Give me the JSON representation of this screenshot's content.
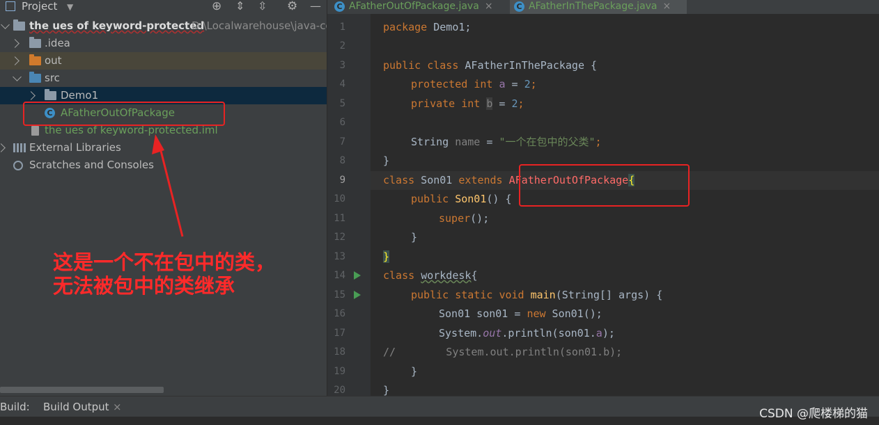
{
  "project_panel": {
    "title": "Project",
    "tree": [
      {
        "label": "the ues of keyword-protected",
        "path": "D:\\Localwarehouse\\java-co",
        "type": "project-root"
      },
      {
        "label": ".idea",
        "type": "folder"
      },
      {
        "label": "out",
        "type": "folder"
      },
      {
        "label": "src",
        "type": "folder"
      },
      {
        "label": "Demo1",
        "type": "package"
      },
      {
        "label": "AFatherOutOfPackage",
        "type": "class"
      },
      {
        "label": "the ues of keyword-protected.iml",
        "type": "file"
      },
      {
        "label": "External Libraries",
        "type": "library"
      },
      {
        "label": "Scratches and Consoles",
        "type": "scratches"
      }
    ]
  },
  "editor": {
    "tabs": [
      {
        "label": "AFatherOutOfPackage.java",
        "active": false
      },
      {
        "label": "AFatherInThePackage.java",
        "active": true
      }
    ],
    "line_numbers": [
      "1",
      "2",
      "3",
      "4",
      "5",
      "6",
      "7",
      "8",
      "9",
      "10",
      "11",
      "12",
      "13",
      "14",
      "15",
      "16",
      "17",
      "18",
      "19",
      "20"
    ],
    "tokens": {
      "package": "package",
      "demo1": " Demo1;",
      "public": "public",
      "class": "class",
      "cls_name": " AFatherInThePackage {",
      "protected": "protected",
      "int": "int",
      "var_a": "a",
      "eq2": " = ",
      "two": "2",
      "semi": ";",
      "private": "private",
      "var_b": "b",
      "string_type": "String",
      "var_name": "name",
      "eq": " = ",
      "string_val": "\"一个在包中的父类\"",
      "close_brace": "}",
      "son01": " Son01 ",
      "extends": "extends",
      "parent": "AFatherOutOfPackage",
      "open_brace": "{",
      "son01_ctor": "Son01",
      "ctor_rest": "() {",
      "super": "super",
      "super_rest": "();",
      "workdesk": "workdesk",
      "static": "static",
      "void": "void",
      "main": "main",
      "main_args": "(String[] args) {",
      "son01_decl": "Son01 son01 = ",
      "new": "new",
      "son01_new": " Son01();",
      "system": "System.",
      "out": "out",
      "println_a": ".println(son01.",
      "paren_semi": ");",
      "comment_line": "//        System.out.println(son01.b);"
    }
  },
  "annotation": {
    "note": "这是一个不在包中的类，\n无法被包中的类继承"
  },
  "build_bar": {
    "label": "Build:",
    "tab": "Build Output",
    "close": "×"
  },
  "watermark": "CSDN @爬楼梯的猫",
  "colors": {
    "annotation_red": "#e82323",
    "editor_bg": "#2b2b2b",
    "panel_bg": "#3c3f41"
  }
}
